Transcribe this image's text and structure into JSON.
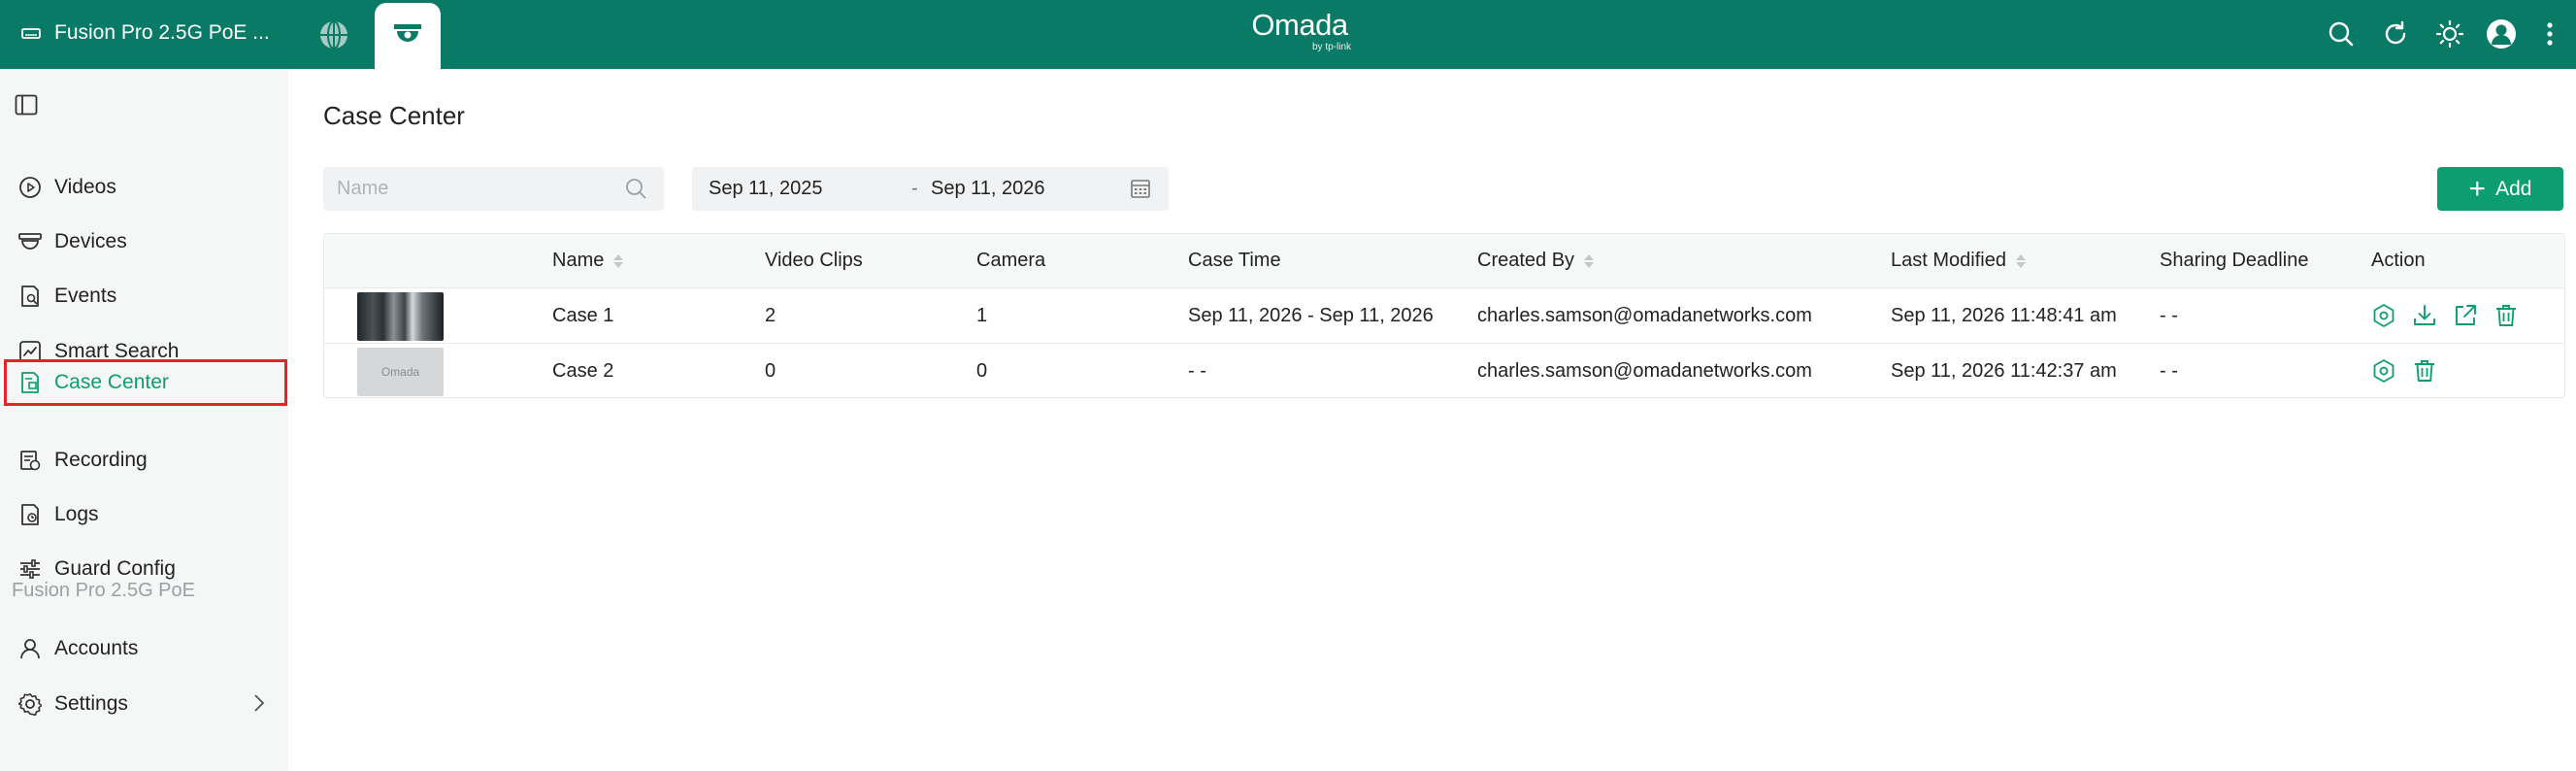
{
  "topbar": {
    "device_name": "Fusion Pro 2.5G PoE ...",
    "logo_main": "Omada",
    "logo_sub": "by tp-link",
    "icons": [
      "search-icon",
      "refresh-icon",
      "brightness-icon",
      "avatar",
      "more-icon"
    ],
    "accent": "#087a66"
  },
  "sidebar": {
    "items": [
      {
        "label": "Videos",
        "icon": "play-circle-icon"
      },
      {
        "label": "Devices",
        "icon": "camera-device-icon"
      },
      {
        "label": "Events",
        "icon": "event-icon"
      },
      {
        "label": "Smart Search",
        "icon": "smart-search-icon"
      },
      {
        "label": "Case Center",
        "icon": "case-icon"
      },
      {
        "label": "Recording",
        "icon": "recording-icon"
      },
      {
        "label": "Logs",
        "icon": "log-icon"
      },
      {
        "label": "Guard Config",
        "icon": "sliders-icon"
      }
    ],
    "section_label": "Fusion Pro 2.5G PoE",
    "bottom_items": [
      {
        "label": "Accounts",
        "icon": "user-icon"
      },
      {
        "label": "Settings",
        "icon": "gear-icon"
      }
    ],
    "active_color": "#0d9e6f"
  },
  "main": {
    "title": "Case Center",
    "search_placeholder": "Name",
    "date_start": "Sep 11, 2025",
    "date_separator": "-",
    "date_end": "Sep 11, 2026",
    "add_label": "Add"
  },
  "table": {
    "columns": [
      "Name",
      "Video Clips",
      "Camera",
      "Case Time",
      "Created By",
      "Last Modified",
      "Sharing Deadline",
      "Action"
    ],
    "rows": [
      {
        "name": "Case 1",
        "video_clips": "2",
        "camera": "1",
        "case_time": "Sep 11, 2026 - Sep 11, 2026",
        "created_by": "charles.samson@omadanetworks.com",
        "last_modified": "Sep 11, 2026 11:48:41 am",
        "sharing_deadline": "- -",
        "thumbnail_label": ""
      },
      {
        "name": "Case 2",
        "video_clips": "0",
        "camera": "0",
        "case_time": "- -",
        "created_by": "charles.samson@omadanetworks.com",
        "last_modified": "Sep 11, 2026 11:42:37 am",
        "sharing_deadline": "- -",
        "thumbnail_label": "Omada"
      }
    ]
  }
}
